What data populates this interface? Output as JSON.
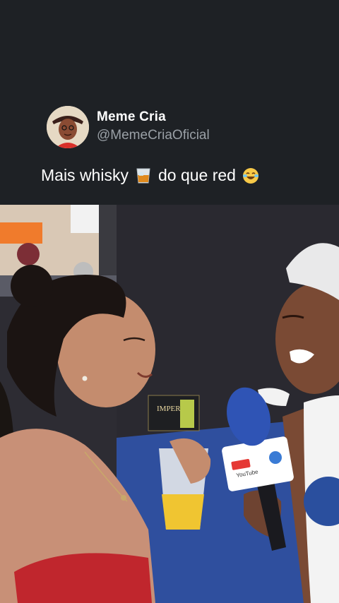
{
  "post": {
    "display_name": "Meme Cria",
    "username": "@MemeCriaOficial",
    "text_before": "Mais whisky",
    "text_after": "do que red",
    "emoji_1": "tumbler-glass-emoji",
    "emoji_2": "face-with-tears-of-joy-emoji"
  },
  "video": {
    "box_label": "IMPERIO",
    "mic_label": "YouTube"
  },
  "colors": {
    "background": "#1e2125",
    "name_text": "#ffffff",
    "handle_text": "#9aa0a6"
  }
}
